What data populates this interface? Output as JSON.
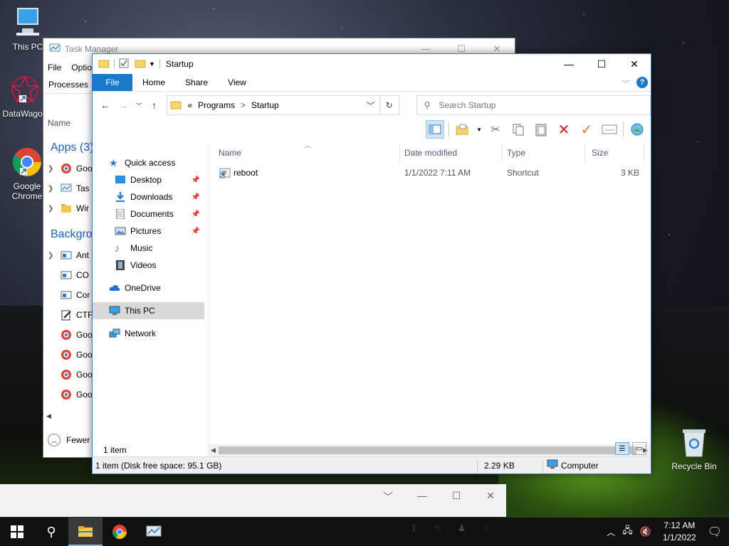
{
  "desktop": {
    "icons": [
      {
        "label": "This PC"
      },
      {
        "label": "DataWagon"
      },
      {
        "label": "Google Chrome"
      },
      {
        "label": "Recycle Bin"
      }
    ]
  },
  "task_manager": {
    "title": "Task Manager",
    "menu": [
      "File",
      "Optio"
    ],
    "tab": "Processes",
    "column": "Name",
    "group_apps": "Apps (3)",
    "group_background": "Backgrou",
    "apps": [
      "Goo",
      "Tas",
      "Wir"
    ],
    "background": [
      "Ant",
      "CO",
      "Cor",
      "CTF",
      "Goo",
      "Goo",
      "Goo",
      "Goo"
    ],
    "fewer_details": "Fewer"
  },
  "explorer": {
    "title": "Startup",
    "ribbon_tabs": {
      "file": "File",
      "home": "Home",
      "share": "Share",
      "view": "View"
    },
    "address": {
      "chevrons": "«",
      "crumb1": "Programs",
      "sep": ">",
      "crumb2": "Startup"
    },
    "search_placeholder": "Search Startup",
    "nav": {
      "quick_access": "Quick access",
      "desktop": "Desktop",
      "downloads": "Downloads",
      "documents": "Documents",
      "pictures": "Pictures",
      "music": "Music",
      "videos": "Videos",
      "onedrive": "OneDrive",
      "this_pc": "This PC",
      "network": "Network"
    },
    "columns": {
      "name": "Name",
      "date": "Date modified",
      "type": "Type",
      "size": "Size"
    },
    "files": [
      {
        "name": "reboot",
        "date": "1/1/2022 7:11 AM",
        "type": "Shortcut",
        "size": "3 KB"
      }
    ],
    "item_count": "1 item",
    "status": {
      "left": "1 item (Disk free space: 95.1 GB)",
      "size": "2.29 KB",
      "location": "Computer"
    }
  },
  "taskbar": {
    "clock_time": "7:12 AM",
    "clock_date": "1/1/2022"
  },
  "colors": {
    "accent": "#1979ca",
    "selection": "#d9d9d9",
    "delete_red": "#d81e1e",
    "check_orange": "#e07a1f"
  }
}
